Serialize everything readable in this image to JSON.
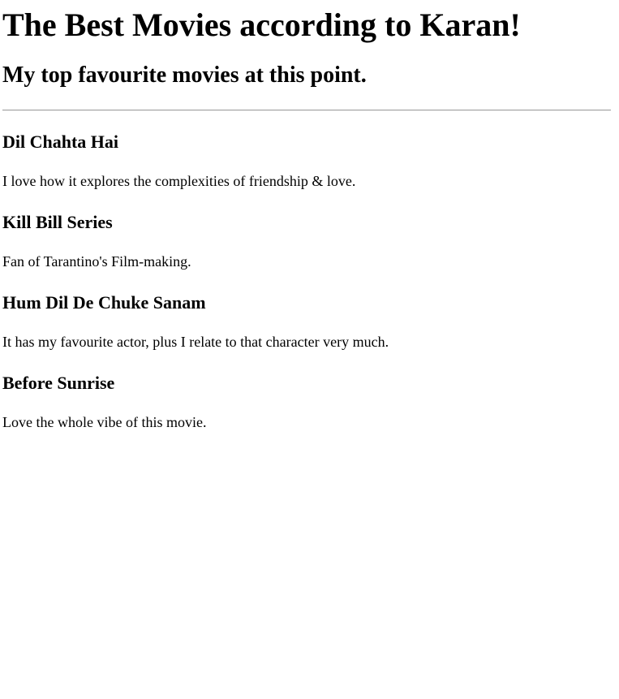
{
  "page": {
    "title": "The Best Movies according to Karan!",
    "subtitle": "My top favourite movies at this point."
  },
  "movies": [
    {
      "title": "Dil Chahta Hai",
      "description": "I love how it explores the complexities of friendship & love."
    },
    {
      "title": "Kill Bill Series",
      "description": "Fan of Tarantino's Film-making."
    },
    {
      "title": "Hum Dil De Chuke Sanam",
      "description": "It has my favourite actor, plus I relate to that character very much."
    },
    {
      "title": "Before Sunrise",
      "description": "Love the whole vibe of this movie."
    }
  ]
}
